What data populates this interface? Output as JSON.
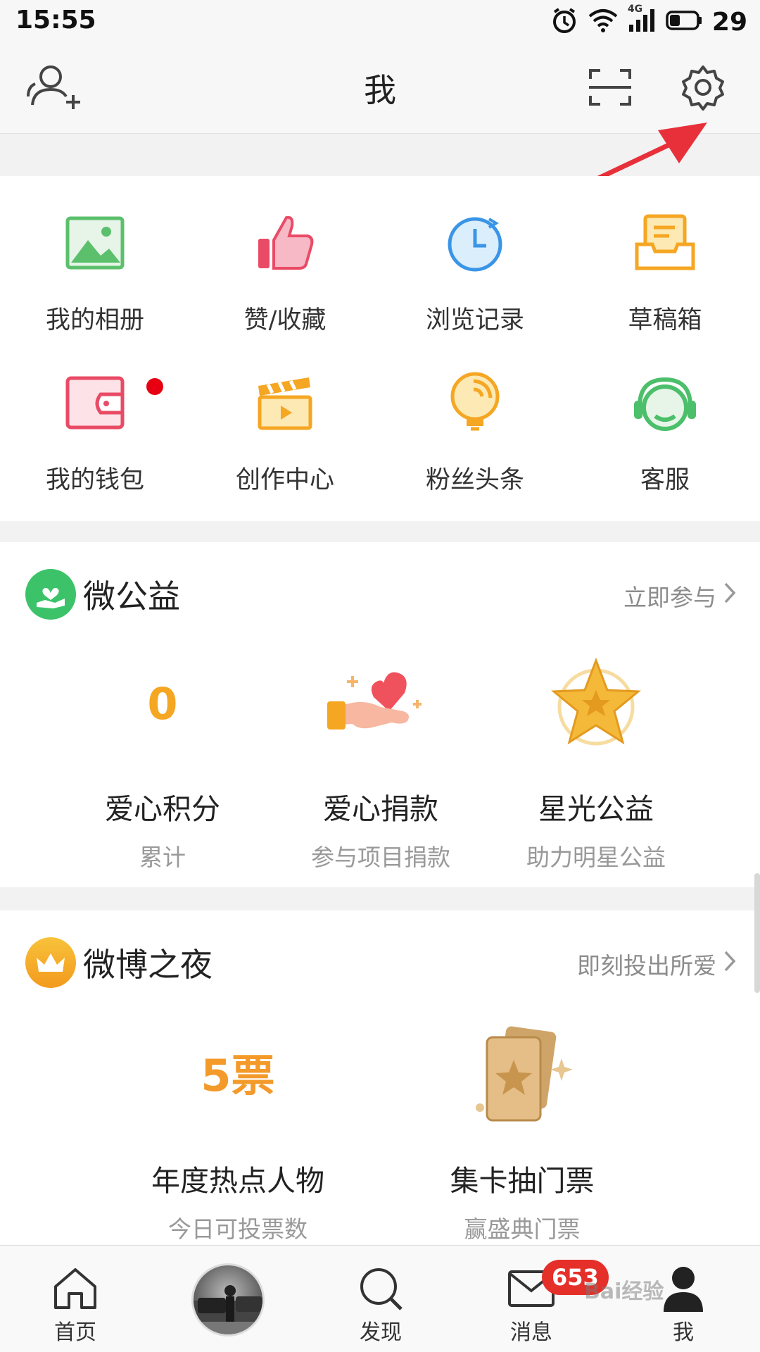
{
  "status_bar": {
    "time": "15:55",
    "network": "4G",
    "battery": "29"
  },
  "header": {
    "title": "我"
  },
  "grid": {
    "items": [
      {
        "label": "我的相册",
        "icon": "photo-album-icon"
      },
      {
        "label": "赞/收藏",
        "icon": "thumbs-up-icon"
      },
      {
        "label": "浏览记录",
        "icon": "history-clock-icon"
      },
      {
        "label": "草稿箱",
        "icon": "drafts-tray-icon"
      },
      {
        "label": "我的钱包",
        "icon": "wallet-icon"
      },
      {
        "label": "创作中心",
        "icon": "clapperboard-icon"
      },
      {
        "label": "粉丝头条",
        "icon": "lightbulb-icon"
      },
      {
        "label": "客服",
        "icon": "headset-icon"
      }
    ]
  },
  "gongyi": {
    "title": "微公益",
    "link": "立即参与",
    "items": [
      {
        "value": "0",
        "title": "爱心积分",
        "sub": "累计"
      },
      {
        "title": "爱心捐款",
        "sub": "参与项目捐款"
      },
      {
        "title": "星光公益",
        "sub": "助力明星公益"
      }
    ]
  },
  "night": {
    "title": "微博之夜",
    "link": "即刻投出所爱",
    "items": [
      {
        "value": "5票",
        "title": "年度热点人物",
        "sub": "今日可投票数"
      },
      {
        "title": "集卡抽门票",
        "sub": "赢盛典门票"
      }
    ]
  },
  "tabs": [
    {
      "label": "首页",
      "icon": "home-icon"
    },
    {
      "label": "发现",
      "icon": "search-icon"
    },
    {
      "label": "消息",
      "icon": "mail-icon",
      "badge": "653"
    },
    {
      "label": "我",
      "icon": "profile-icon"
    }
  ],
  "watermark": "Bai经验",
  "colors": {
    "accent_orange": "#f5a623",
    "badge_red": "#e5302a",
    "gongyi_green": "#3cc36a",
    "arrow_red": "#e8303a"
  }
}
